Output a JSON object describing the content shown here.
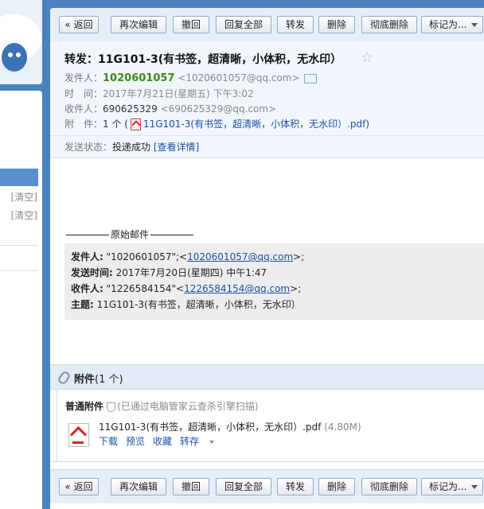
{
  "toolbar": {
    "back": "« 返回",
    "edit_again": "再次编辑",
    "recall": "撤回",
    "reply_all": "回复全部",
    "forward": "转发",
    "delete": "删除",
    "delete_permanently": "彻底删除",
    "mark_as": "标记为..."
  },
  "mail": {
    "subject": "转发：11G101-3(有书签，超清晰，小体积，无水印）",
    "sender_label": "发件人：",
    "sender_name": "1020601057",
    "sender_email": "<1020601057@qq.com>",
    "time_label": "时　间：",
    "time_value": "2017年7月21日(星期五) 下午3:02",
    "recipient_label": "收件人：",
    "recipient_name": "690625329",
    "recipient_email": "<690625329@qq.com>",
    "attachment_label": "附　件：",
    "attachment_count": "1 个 (",
    "attachment_name": "11G101-3(有书签，超清晰，小体积，无水印）.pdf",
    "attachment_close": ")",
    "status_label": "发送状态：",
    "status_value": "投递成功",
    "status_detail": "[查看详情]"
  },
  "body": {
    "original_title": "原始邮件",
    "from_label": "发件人:",
    "from_value": " \"1020601057\";<",
    "from_email": "1020601057@qq.com",
    "from_end": ">;",
    "sent_label": "发送时间:",
    "sent_value": " 2017年7月20日(星期四) 中午1:47",
    "to_label": "收件人:",
    "to_value": " \"1226584154\"<",
    "to_email": "1226584154@qq.com",
    "to_end": ">;",
    "subject_label": "主题:",
    "subject_value": " 11G101-3(有书签，超清晰，小体积，无水印）"
  },
  "attachments": {
    "header_title": "附件",
    "header_count": "(1 个)",
    "normal_label": "普通附件",
    "scan_note": "(已通过电脑管家云查杀引擎扫描)",
    "file_name": "11G101-3(有书签，超清晰，小体积，无水印）.pdf",
    "file_size": "(4.80M)",
    "download": "下载",
    "preview": "预览",
    "collect": "收藏",
    "save_to": "转存"
  },
  "sidebar": {
    "clear_1": "[清空]",
    "clear_2": "[清空]"
  },
  "colors": {
    "background": "#4a82bf",
    "sender_name": "#3a8a1a",
    "link": "#1e50a2",
    "toolbar": "#e6eef8",
    "header": "#f1f6fc"
  }
}
